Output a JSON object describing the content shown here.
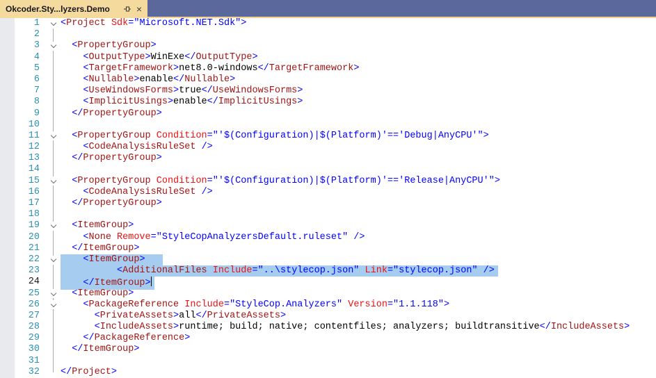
{
  "window": {
    "tab": {
      "title": "Okcoder.Sty...lyzers.Demo",
      "close_glyph": "×"
    }
  },
  "colors": {
    "tabstrip-bg": "#5A689B",
    "tab-bg": "#F5DA9E",
    "tab-underline": "#F2D28E",
    "tab-fg": "#15151F",
    "gutter-bg": "#E9EAEE",
    "lnum": "#2B91AF",
    "lnum-current": "#1A1A1A",
    "sel-bg": "#A6CDF0",
    "outline": "#ABABAB",
    "chevron": "#6F6F6F",
    "xml-delim": "#0000FF",
    "xml-name": "#A31515",
    "xml-attr": "#EE1111",
    "xml-text": "#000000"
  },
  "editor": {
    "lines": [
      {
        "n": 1,
        "fold": true,
        "parts": [
          [
            "d",
            "<"
          ],
          [
            "e",
            "Project"
          ],
          [
            "t",
            " "
          ],
          [
            "a",
            "Sdk"
          ],
          [
            "d",
            "=\"Microsoft.NET.Sdk\">"
          ]
        ]
      },
      {
        "n": 2,
        "parts": []
      },
      {
        "n": 3,
        "fold": true,
        "parts": [
          [
            "t",
            "  "
          ],
          [
            "d",
            "<"
          ],
          [
            "e",
            "PropertyGroup"
          ],
          [
            "d",
            ">"
          ]
        ]
      },
      {
        "n": 4,
        "parts": [
          [
            "t",
            "    "
          ],
          [
            "d",
            "<"
          ],
          [
            "e",
            "OutputType"
          ],
          [
            "d",
            ">"
          ],
          [
            "t",
            "WinExe"
          ],
          [
            "d",
            "</"
          ],
          [
            "e",
            "OutputType"
          ],
          [
            "d",
            ">"
          ]
        ]
      },
      {
        "n": 5,
        "parts": [
          [
            "t",
            "    "
          ],
          [
            "d",
            "<"
          ],
          [
            "e",
            "TargetFramework"
          ],
          [
            "d",
            ">"
          ],
          [
            "t",
            "net8.0-windows"
          ],
          [
            "d",
            "</"
          ],
          [
            "e",
            "TargetFramework"
          ],
          [
            "d",
            ">"
          ]
        ]
      },
      {
        "n": 6,
        "parts": [
          [
            "t",
            "    "
          ],
          [
            "d",
            "<"
          ],
          [
            "e",
            "Nullable"
          ],
          [
            "d",
            ">"
          ],
          [
            "t",
            "enable"
          ],
          [
            "d",
            "</"
          ],
          [
            "e",
            "Nullable"
          ],
          [
            "d",
            ">"
          ]
        ]
      },
      {
        "n": 7,
        "parts": [
          [
            "t",
            "    "
          ],
          [
            "d",
            "<"
          ],
          [
            "e",
            "UseWindowsForms"
          ],
          [
            "d",
            ">"
          ],
          [
            "t",
            "true"
          ],
          [
            "d",
            "</"
          ],
          [
            "e",
            "UseWindowsForms"
          ],
          [
            "d",
            ">"
          ]
        ]
      },
      {
        "n": 8,
        "parts": [
          [
            "t",
            "    "
          ],
          [
            "d",
            "<"
          ],
          [
            "e",
            "ImplicitUsings"
          ],
          [
            "d",
            ">"
          ],
          [
            "t",
            "enable"
          ],
          [
            "d",
            "</"
          ],
          [
            "e",
            "ImplicitUsings"
          ],
          [
            "d",
            ">"
          ]
        ]
      },
      {
        "n": 9,
        "parts": [
          [
            "t",
            "  "
          ],
          [
            "d",
            "</"
          ],
          [
            "e",
            "PropertyGroup"
          ],
          [
            "d",
            ">"
          ]
        ]
      },
      {
        "n": 10,
        "parts": []
      },
      {
        "n": 11,
        "fold": true,
        "parts": [
          [
            "t",
            "  "
          ],
          [
            "d",
            "<"
          ],
          [
            "e",
            "PropertyGroup"
          ],
          [
            "t",
            " "
          ],
          [
            "a",
            "Condition"
          ],
          [
            "d",
            "=\"'$(Configuration)|$(Platform)'=='Debug|AnyCPU'\">"
          ]
        ]
      },
      {
        "n": 12,
        "parts": [
          [
            "t",
            "    "
          ],
          [
            "d",
            "<"
          ],
          [
            "e",
            "CodeAnalysisRuleSet"
          ],
          [
            "t",
            " "
          ],
          [
            "d",
            "/>"
          ]
        ]
      },
      {
        "n": 13,
        "parts": [
          [
            "t",
            "  "
          ],
          [
            "d",
            "</"
          ],
          [
            "e",
            "PropertyGroup"
          ],
          [
            "d",
            ">"
          ]
        ]
      },
      {
        "n": 14,
        "parts": []
      },
      {
        "n": 15,
        "fold": true,
        "parts": [
          [
            "t",
            "  "
          ],
          [
            "d",
            "<"
          ],
          [
            "e",
            "PropertyGroup"
          ],
          [
            "t",
            " "
          ],
          [
            "a",
            "Condition"
          ],
          [
            "d",
            "=\"'$(Configuration)|$(Platform)'=='Release|AnyCPU'\">"
          ]
        ]
      },
      {
        "n": 16,
        "parts": [
          [
            "t",
            "    "
          ],
          [
            "d",
            "<"
          ],
          [
            "e",
            "CodeAnalysisRuleSet"
          ],
          [
            "t",
            " "
          ],
          [
            "d",
            "/>"
          ]
        ]
      },
      {
        "n": 17,
        "parts": [
          [
            "t",
            "  "
          ],
          [
            "d",
            "</"
          ],
          [
            "e",
            "PropertyGroup"
          ],
          [
            "d",
            ">"
          ]
        ]
      },
      {
        "n": 18,
        "parts": []
      },
      {
        "n": 19,
        "fold": true,
        "parts": [
          [
            "t",
            "  "
          ],
          [
            "d",
            "<"
          ],
          [
            "e",
            "ItemGroup"
          ],
          [
            "d",
            ">"
          ]
        ]
      },
      {
        "n": 20,
        "parts": [
          [
            "t",
            "    "
          ],
          [
            "d",
            "<"
          ],
          [
            "e",
            "None"
          ],
          [
            "t",
            " "
          ],
          [
            "a",
            "Remove"
          ],
          [
            "d",
            "=\"StyleCopAnalyzersDefault.ruleset\""
          ],
          [
            "t",
            " "
          ],
          [
            "d",
            "/>"
          ]
        ]
      },
      {
        "n": 21,
        "parts": [
          [
            "t",
            "  "
          ],
          [
            "d",
            "</"
          ],
          [
            "e",
            "ItemGroup"
          ],
          [
            "d",
            ">"
          ]
        ]
      },
      {
        "n": 22,
        "fold": true,
        "sel": true,
        "selPad": 25,
        "parts": [
          [
            "t",
            "    "
          ],
          [
            "d",
            "<"
          ],
          [
            "e",
            "ItemGroup"
          ],
          [
            "d",
            ">"
          ]
        ]
      },
      {
        "n": 23,
        "sel": true,
        "selPad": 5,
        "parts": [
          [
            "t",
            "          "
          ],
          [
            "d",
            "<"
          ],
          [
            "e",
            "AdditionalFiles"
          ],
          [
            "t",
            " "
          ],
          [
            "a",
            "Include"
          ],
          [
            "d",
            "=\"..\\stylecop.json\""
          ],
          [
            "t",
            " "
          ],
          [
            "a",
            "Link"
          ],
          [
            "d",
            "=\"stylecop.json\""
          ],
          [
            "t",
            " "
          ],
          [
            "d",
            "/>"
          ]
        ]
      },
      {
        "n": 24,
        "sel": true,
        "selPad": 4,
        "caret": true,
        "parts": [
          [
            "t",
            "    "
          ],
          [
            "d",
            "</"
          ],
          [
            "e",
            "ItemGroup"
          ],
          [
            "d",
            ">"
          ]
        ]
      },
      {
        "n": 25,
        "fold": true,
        "parts": [
          [
            "t",
            "  "
          ],
          [
            "d",
            "<"
          ],
          [
            "e",
            "ItemGroup"
          ],
          [
            "d",
            ">"
          ]
        ]
      },
      {
        "n": 26,
        "fold": true,
        "parts": [
          [
            "t",
            "    "
          ],
          [
            "d",
            "<"
          ],
          [
            "e",
            "PackageReference"
          ],
          [
            "t",
            " "
          ],
          [
            "a",
            "Include"
          ],
          [
            "d",
            "=\"StyleCop.Analyzers\""
          ],
          [
            "t",
            " "
          ],
          [
            "a",
            "Version"
          ],
          [
            "d",
            "=\"1.1.118\">"
          ]
        ]
      },
      {
        "n": 27,
        "parts": [
          [
            "t",
            "      "
          ],
          [
            "d",
            "<"
          ],
          [
            "e",
            "PrivateAssets"
          ],
          [
            "d",
            ">"
          ],
          [
            "t",
            "all"
          ],
          [
            "d",
            "</"
          ],
          [
            "e",
            "PrivateAssets"
          ],
          [
            "d",
            ">"
          ]
        ]
      },
      {
        "n": 28,
        "parts": [
          [
            "t",
            "      "
          ],
          [
            "d",
            "<"
          ],
          [
            "e",
            "IncludeAssets"
          ],
          [
            "d",
            ">"
          ],
          [
            "t",
            "runtime; build; native; contentfiles; analyzers; buildtransitive"
          ],
          [
            "d",
            "</"
          ],
          [
            "e",
            "IncludeAssets"
          ],
          [
            "d",
            ">"
          ]
        ]
      },
      {
        "n": 29,
        "parts": [
          [
            "t",
            "    "
          ],
          [
            "d",
            "</"
          ],
          [
            "e",
            "PackageReference"
          ],
          [
            "d",
            ">"
          ]
        ]
      },
      {
        "n": 30,
        "parts": [
          [
            "t",
            "  "
          ],
          [
            "d",
            "</"
          ],
          [
            "e",
            "ItemGroup"
          ],
          [
            "d",
            ">"
          ]
        ]
      },
      {
        "n": 31,
        "parts": []
      },
      {
        "n": 32,
        "parts": [
          [
            "d",
            "</"
          ],
          [
            "e",
            "Project"
          ],
          [
            "d",
            ">"
          ]
        ]
      }
    ]
  }
}
